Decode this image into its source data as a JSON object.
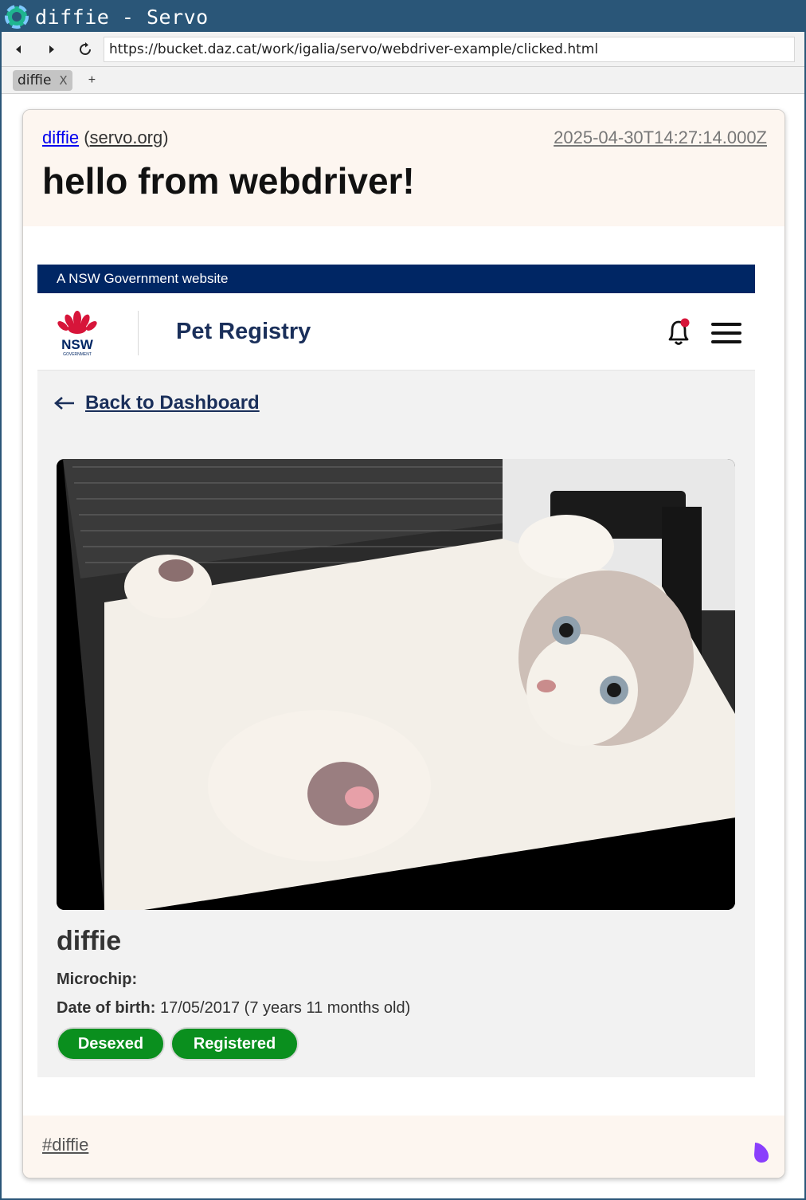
{
  "window": {
    "title": "diffie - Servo"
  },
  "navbar": {
    "url": "https://bucket.daz.cat/work/igalia/servo/webdriver-example/clicked.html"
  },
  "tabs": [
    {
      "label": "diffie",
      "close": "X"
    }
  ],
  "new_tab_label": "+",
  "post": {
    "author": "diffie",
    "instance": "servo.org",
    "instance_open": "(",
    "instance_close": ")",
    "timestamp": "2025-04-30T14:27:14.000Z",
    "title": "hello from webdriver!",
    "hashtag": "#diffie"
  },
  "screenshot": {
    "gov_banner": "A NSW Government website",
    "logo_text": "NSW",
    "logo_subtext": "GOVERNMENT",
    "app_title": "Pet Registry",
    "back_link": "Back to Dashboard",
    "pet_name": "diffie",
    "microchip_label": "Microchip:",
    "microchip_value": "",
    "dob_label": "Date of birth:",
    "dob_value": "17/05/2017 (7 years 11 months old)",
    "chips": [
      "Desexed",
      "Registered"
    ]
  },
  "colors": {
    "titlebar": "#2a5678",
    "gov_navy": "#002664",
    "chip_green": "#0a8f1e",
    "waratah_red": "#d7153a",
    "blob_purple": "#8a3ffc"
  },
  "icons": {
    "app_logo": "servo-logo-icon",
    "back": "back-arrow-icon",
    "forward": "forward-arrow-icon",
    "reload": "reload-icon",
    "bell": "bell-icon",
    "menu": "hamburger-menu-icon",
    "blob": "blob-icon"
  }
}
